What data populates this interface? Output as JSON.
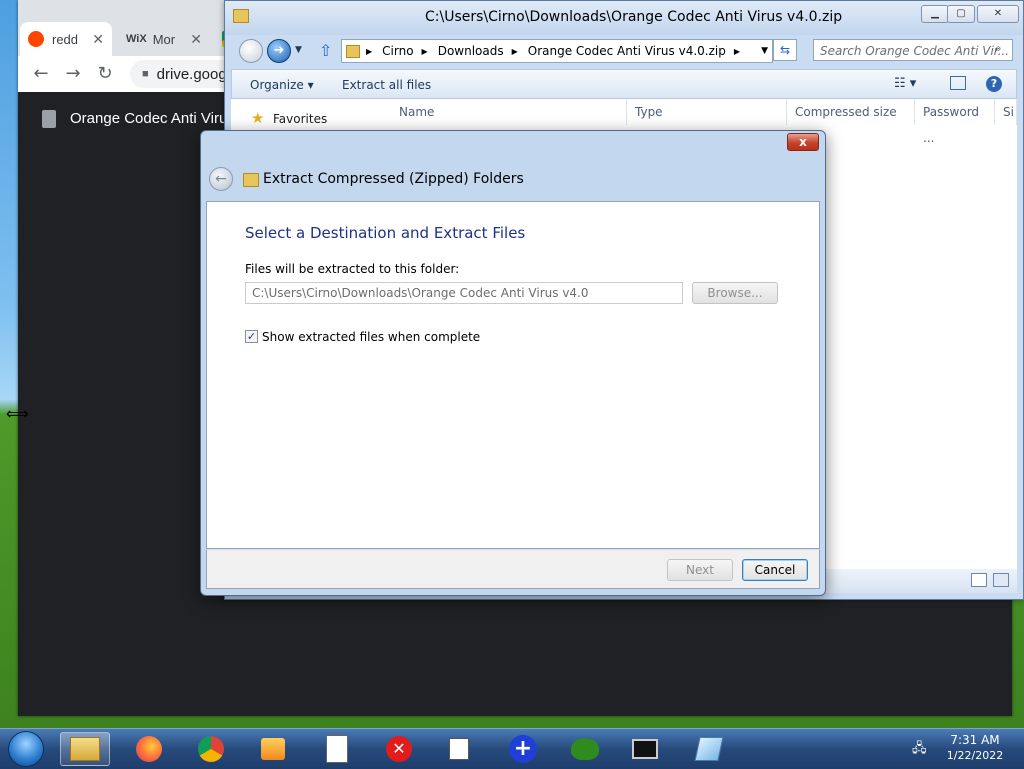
{
  "chrome": {
    "tabs": [
      {
        "label": "redd",
        "icon": "reddit-icon"
      },
      {
        "label": "Mor",
        "icon": "wix-icon",
        "icon_text": "WiX"
      },
      {
        "label": "",
        "icon": "google-drive-icon"
      }
    ],
    "url": "drive.goog",
    "drive_file_title": "Orange Codec Anti Virus"
  },
  "explorer": {
    "title": "C:\\Users\\Cirno\\Downloads\\Orange Codec Anti Virus v4.0.zip",
    "breadcrumb": [
      "Cirno",
      "Downloads",
      "Orange Codec Anti Virus v4.0.zip"
    ],
    "search_placeholder": "Search Orange Codec Anti Vir...",
    "commands": {
      "organize": "Organize",
      "extract_all": "Extract all files"
    },
    "nav": {
      "favorites": "Favorites"
    },
    "columns": [
      "Name",
      "Type",
      "Compressed size",
      "Password ...",
      "Si"
    ]
  },
  "dialog": {
    "title": "Extract Compressed (Zipped) Folders",
    "heading": "Select a Destination and Extract Files",
    "destination_label": "Files will be extracted to this folder:",
    "destination_path": "C:\\Users\\Cirno\\Downloads\\Orange Codec Anti Virus v4.0",
    "browse_label": "Browse...",
    "checkbox_label": "Show extracted files when complete",
    "checkbox_checked": true,
    "next_label": "Next",
    "cancel_label": "Cancel",
    "close_glyph": "x"
  },
  "taskbar": {
    "time": "7:31 AM",
    "date": "1/22/2022",
    "apps": [
      "file-explorer-icon",
      "firefox-icon",
      "chrome-icon",
      "media-player-icon",
      "notepad-icon",
      "red-x-icon",
      "folder-icon",
      "blue-plus-icon",
      "tree-icon",
      "monitor-icon",
      "cube-icon"
    ]
  },
  "colors": {
    "dialog_heading": "#1e3287",
    "accent": "#2e7fd1"
  }
}
